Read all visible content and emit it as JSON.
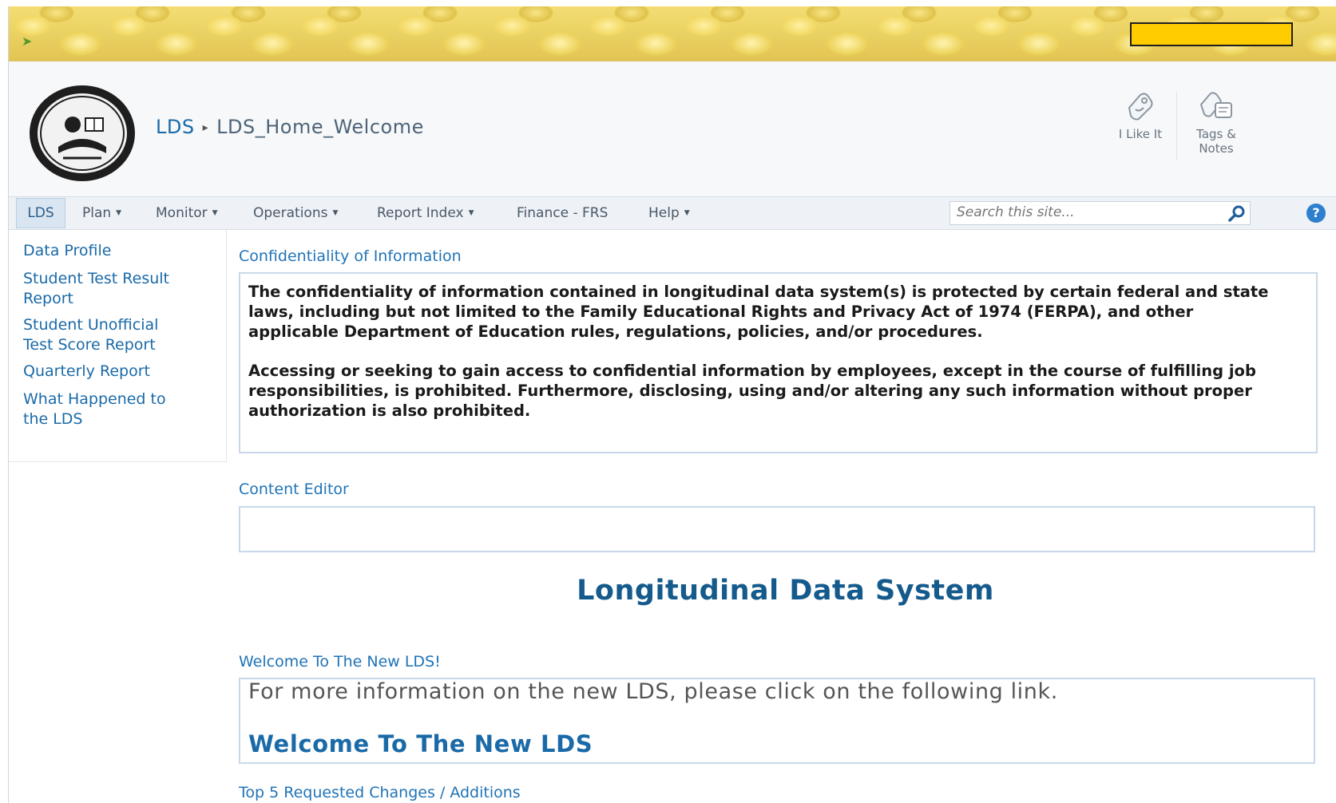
{
  "breadcrumb": {
    "site": "LDS",
    "page": "LDS_Home_Welcome"
  },
  "social": {
    "like_label": "I Like It",
    "tags_label_1": "Tags &",
    "tags_label_2": "Notes"
  },
  "nav": {
    "items": [
      {
        "label": "LDS"
      },
      {
        "label": "Plan"
      },
      {
        "label": "Monitor"
      },
      {
        "label": "Operations"
      },
      {
        "label": "Report Index"
      },
      {
        "label": "Finance - FRS"
      },
      {
        "label": "Help"
      }
    ],
    "search_placeholder": "Search this site...",
    "help_glyph": "?"
  },
  "left_nav": {
    "items": [
      {
        "line1": "Data Profile"
      },
      {
        "line1": "Student Test Result",
        "line2": "Report"
      },
      {
        "line1": "Student Unofficial",
        "line2": "Test Score Report"
      },
      {
        "line1": "Quarterly Report"
      },
      {
        "line1": "What Happened to",
        "line2": "the LDS"
      }
    ]
  },
  "confidentiality": {
    "title": "Confidentiality of Information",
    "paragraph1": "The confidentiality of information contained in longitudinal data system(s) is protected by certain federal and state laws, including but not limited to the Family Educational Rights and Privacy Act of 1974 (FERPA), and other applicable Department of Education rules, regulations, policies, and/or procedures.",
    "paragraph2": "Accessing or seeking to gain access to confidential information by employees, except in the course of fulfilling job responsibilities, is prohibited. Furthermore, disclosing, using and/or altering any such information without proper authorization is also prohibited."
  },
  "content_editor": {
    "title": "Content Editor"
  },
  "main_title": "Longitudinal Data System",
  "welcome": {
    "title": "Welcome To The New LDS!",
    "info_text": "For more information on the new LDS, please click on the following link.",
    "link_text": "Welcome To The New LDS"
  },
  "top5": {
    "title": "Top 5 Requested Changes / Additions"
  },
  "colors": {
    "link": "#1a6aa8",
    "title": "#145a8c",
    "banner_box": "#ffcc00"
  }
}
